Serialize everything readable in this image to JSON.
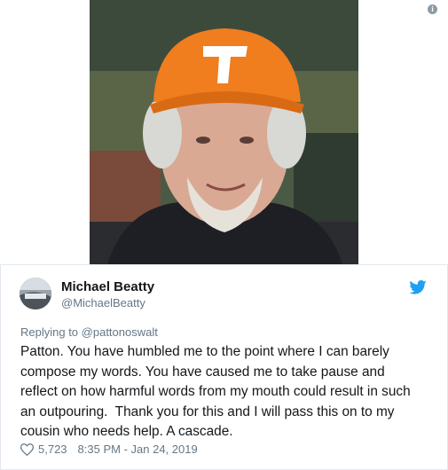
{
  "tweet": {
    "author_name": "Michael Beatty",
    "author_handle": "@MichaelBeatty",
    "reply_prefix": "Replying to ",
    "reply_handle": "@pattonoswalt",
    "text": "Patton. You have humbled me to the point where I can barely\ncompose my words. You have caused me to take pause and\nreflect on how harmful words from my mouth could result in such\nan outpouring.  Thank you for this and I will pass this on to my\ncousin who needs help. A cascade.",
    "like_count": "5,723",
    "timestamp": "8:35 PM - Jan 24, 2019"
  },
  "photo": {
    "description_icon": "info-icon",
    "hat_letter": "T"
  },
  "icons": {
    "twitter": "twitter-bird-icon",
    "like": "heart-icon",
    "info": "info-icon"
  },
  "colors": {
    "twitter_blue": "#1da1f2",
    "secondary_text": "#657786",
    "primary_text": "#14171a",
    "hat_orange": "#f07d1e"
  }
}
